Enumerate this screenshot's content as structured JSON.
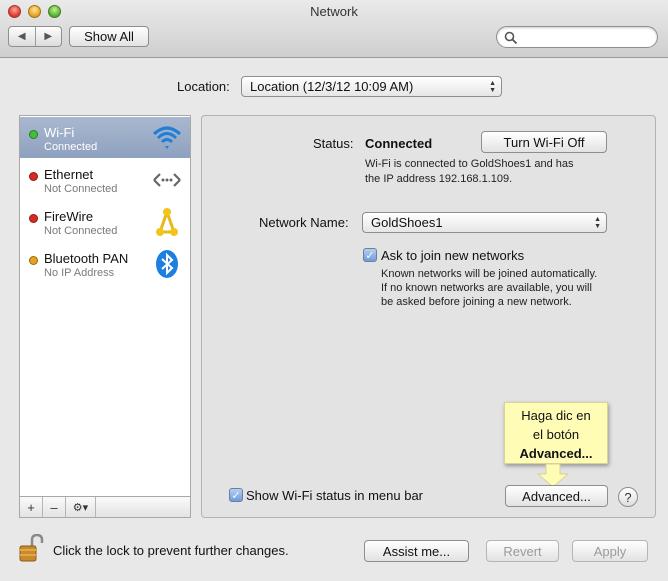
{
  "window": {
    "title": "Network"
  },
  "toolbar": {
    "back_glyph": "◀",
    "forward_glyph": "▶",
    "show_all_label": "Show All",
    "search_placeholder": ""
  },
  "location": {
    "label": "Location:",
    "value": "Location (12/3/12 10:09 AM)"
  },
  "services": [
    {
      "name": "Wi-Fi",
      "status": "Connected",
      "dot_color": "#3fbf3a",
      "icon": "wifi-icon",
      "selected": true
    },
    {
      "name": "Ethernet",
      "status": "Not Connected",
      "dot_color": "#d72b22",
      "icon": "ethernet-icon",
      "selected": false
    },
    {
      "name": "FireWire",
      "status": "Not Connected",
      "dot_color": "#d72b22",
      "icon": "firewire-icon",
      "selected": false
    },
    {
      "name": "Bluetooth PAN",
      "status": "No IP Address",
      "dot_color": "#e8a11c",
      "icon": "bluetooth-icon",
      "selected": false
    }
  ],
  "sidebar_controls": {
    "add": "+",
    "remove": "–",
    "action": "⚙▾"
  },
  "detail": {
    "status_label": "Status:",
    "status_value": "Connected",
    "turn_off_button": "Turn Wi-Fi Off",
    "status_desc_line1": "Wi-Fi is connected to GoldShoes1 and has",
    "status_desc_line2": "the IP address 192.168.1.109.",
    "network_name_label": "Network Name:",
    "network_name_value": "GoldShoes1",
    "ask_join_label": "Ask to join new networks",
    "ask_join_checked": true,
    "ask_desc_line1": "Known networks will be joined automatically.",
    "ask_desc_line2": "If no known networks are available, you will",
    "ask_desc_line3": "be asked before joining a new network.",
    "show_status_label": "Show Wi-Fi status in menu bar",
    "show_status_checked": true,
    "advanced_button": "Advanced...",
    "help_label": "?"
  },
  "tooltip": {
    "line1": "Haga dic en",
    "line2": "el botón",
    "line3": "Advanced..."
  },
  "footer": {
    "lock_text": "Click the lock to prevent further changes.",
    "assist_button": "Assist me...",
    "revert_button": "Revert",
    "apply_button": "Apply"
  },
  "colors": {
    "selection": "#9aabc6",
    "tooltip_bg": "#fffdb5"
  }
}
